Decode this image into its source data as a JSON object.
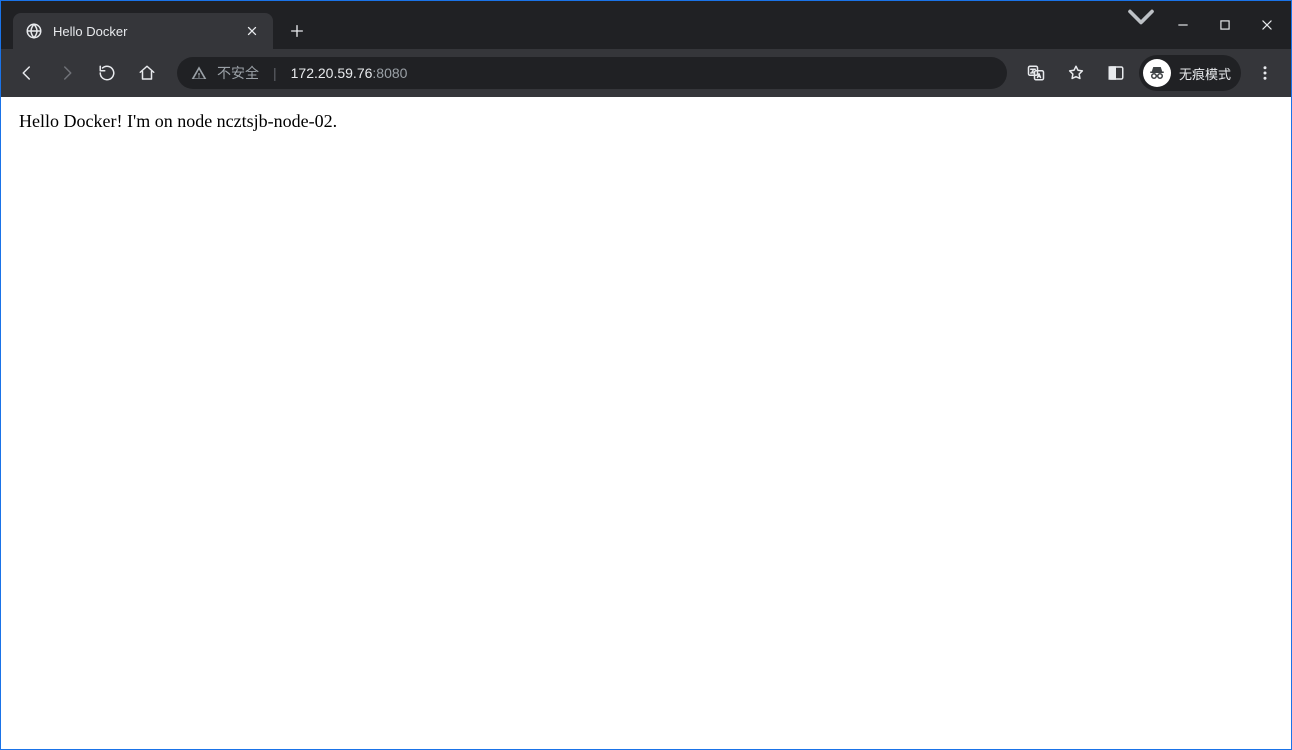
{
  "window": {
    "tab_title": "Hello Docker",
    "incognito_label": "无痕模式"
  },
  "omnibox": {
    "security_text": "不安全",
    "url_host": "172.20.59.76",
    "url_port": ":8080"
  },
  "page": {
    "body_text": "Hello Docker! I'm on node ncztsjb-node-02."
  }
}
